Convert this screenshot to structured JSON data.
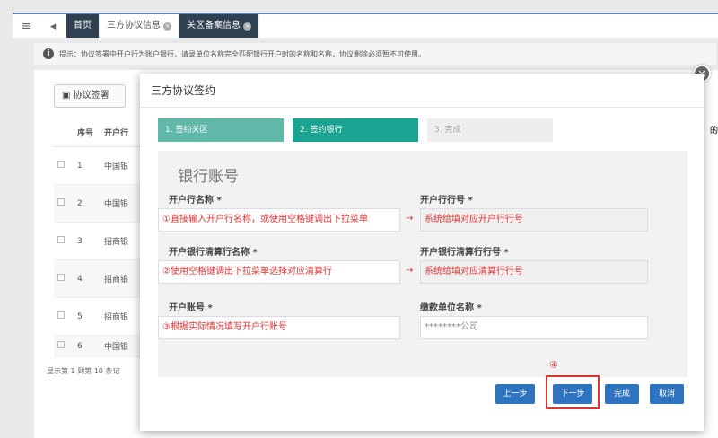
{
  "topbar": {
    "menu_icon": "≡",
    "back_icon": "◂",
    "tabs": [
      {
        "label": "首页"
      },
      {
        "label": "三方协议信息"
      },
      {
        "label": "关区备案信息"
      }
    ],
    "close_glyph": "×"
  },
  "hint": {
    "icon": "i",
    "text": "提示：协议签署中开户行为账户银行，请录单位名称完全匹配银行开户时的名称和名称，协议删除必须暂不可使用。"
  },
  "background": {
    "sign_button": "协议签署",
    "headers": [
      "",
      "序号",
      "开户行"
    ],
    "rows": [
      {
        "no": "1",
        "bank": "中国银"
      },
      {
        "no": "2",
        "bank": "中国银"
      },
      {
        "no": "3",
        "bank": "招商银"
      },
      {
        "no": "4",
        "bank": "招商银"
      },
      {
        "no": "5",
        "bank": "招商银"
      },
      {
        "no": "6",
        "bank": "中国银"
      }
    ],
    "footer": "显示第 1 到第 10 条记",
    "right_header": "的"
  },
  "modal": {
    "title": "三方协议签约",
    "close_icon": "×",
    "steps": [
      "1. 签约关区",
      "2. 签约银行",
      "3. 完成"
    ],
    "section_title": "银行账号",
    "fields": {
      "bank_name_label": "开户行名称 *",
      "bank_name_value": "①直接输入开户行名称，或使用空格键调出下拉菜单",
      "bank_code_label": "开户行行号 *",
      "bank_code_value": "系统给填对应开户行行号",
      "clearing_name_label": "开户银行清算行名称 *",
      "clearing_name_value": "②使用空格键调出下拉菜单选择对应清算行",
      "clearing_code_label": "开户银行清算行行号 *",
      "clearing_code_value": "系统给填对应清算行行号",
      "account_label": "开户账号 *",
      "account_value": "③根据实际情况填写开户行账号",
      "payer_label": "缴款单位名称 *",
      "payer_value": "********公司"
    },
    "arrow": "→",
    "step_marker": "④",
    "buttons": {
      "prev": "上一步",
      "next": "下一步",
      "finish": "完成",
      "cancel": "取消"
    }
  },
  "colors": {
    "step_active": "#1aa390",
    "step_done": "#5fb8a8",
    "button_blue": "#2f74c0",
    "annotation_red": "#dd3333"
  }
}
